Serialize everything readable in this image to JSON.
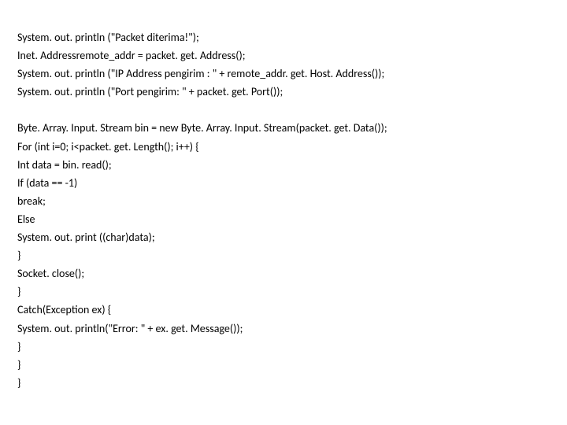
{
  "lines": [
    "System. out. println (\"Packet diterima!\");",
    "Inet. Addressremote_addr = packet. get. Address();",
    "System. out. println (\"IP Address pengirim : \" + remote_addr. get. Host. Address());",
    "System. out. println (\"Port pengirim: \" + packet. get. Port());",
    "",
    "Byte. Array. Input. Stream bin = new Byte. Array. Input. Stream(packet. get. Data());",
    "For (int i=0; i<packet. get. Length(); i++) {",
    "Int data = bin. read();",
    "If (data == -1)",
    "break;",
    "Else",
    "System. out. print ((char)data);",
    "}",
    "Socket. close();",
    "}",
    "Catch(Exception ex) {",
    "System. out. println(\"Error: \" + ex. get. Message());",
    "}",
    "}",
    "}"
  ]
}
